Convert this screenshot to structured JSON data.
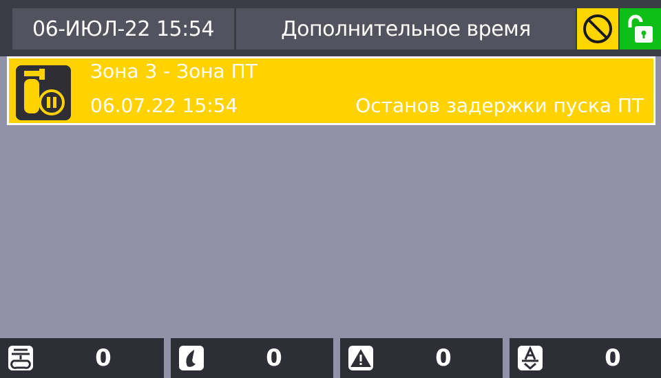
{
  "header": {
    "datetime": "06-ИЮЛ-22 15:54",
    "mode": "Дополнительное время",
    "icons": [
      "disabled-icon",
      "unlocked-icon"
    ]
  },
  "event": {
    "icon": "extinguisher-pause-icon",
    "zone": "Зона 3 - Зона ПТ",
    "time": "06.07.22 15:54",
    "description": "Останов задержки пуска ПТ"
  },
  "counters": [
    {
      "icon": "fire-detector-icon",
      "value": "0"
    },
    {
      "icon": "fire-flame-icon",
      "value": "0"
    },
    {
      "icon": "warning-icon",
      "value": "0"
    },
    {
      "icon": "service-icon",
      "value": "0"
    }
  ],
  "colors": {
    "background": "#9191a8",
    "header": "#3c3c46",
    "event": "#ffd200",
    "lock": "#0fbf18"
  }
}
